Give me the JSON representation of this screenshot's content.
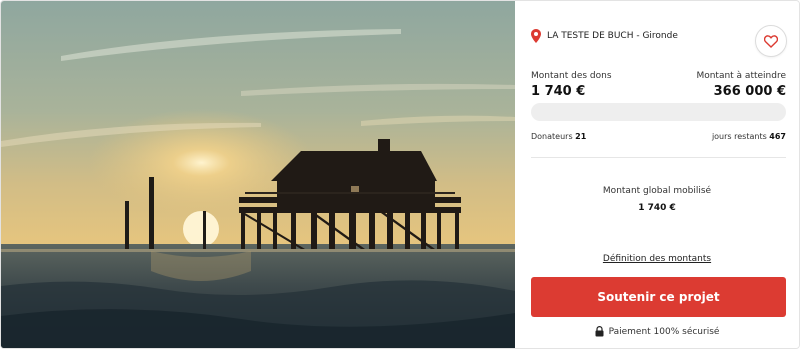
{
  "location": {
    "icon": "map-pin-icon",
    "text": "LA TESTE DE BUCH - Gironde"
  },
  "favorite": {
    "icon": "heart-icon"
  },
  "donations": {
    "raised_label": "Montant des dons",
    "raised_value": "1 740 €",
    "goal_label": "Montant à atteindre",
    "goal_value": "366 000 €",
    "progress_fraction": 0.0
  },
  "stats": {
    "donors_label": "Donateurs",
    "donors_value": "21",
    "days_label": "jours restants",
    "days_value": "467"
  },
  "global": {
    "label": "Montant global mobilisé",
    "value": "1 740 €"
  },
  "definition_link": "Définition des montants",
  "cta_label": "Soutenir ce projet",
  "secure": {
    "icon": "lock-icon",
    "text": "Paiement 100% sécurisé"
  },
  "colors": {
    "accent": "#dc3b32",
    "progress_track": "#eeeeee"
  },
  "photo": {
    "subject": "stilt-house-at-sunset"
  }
}
